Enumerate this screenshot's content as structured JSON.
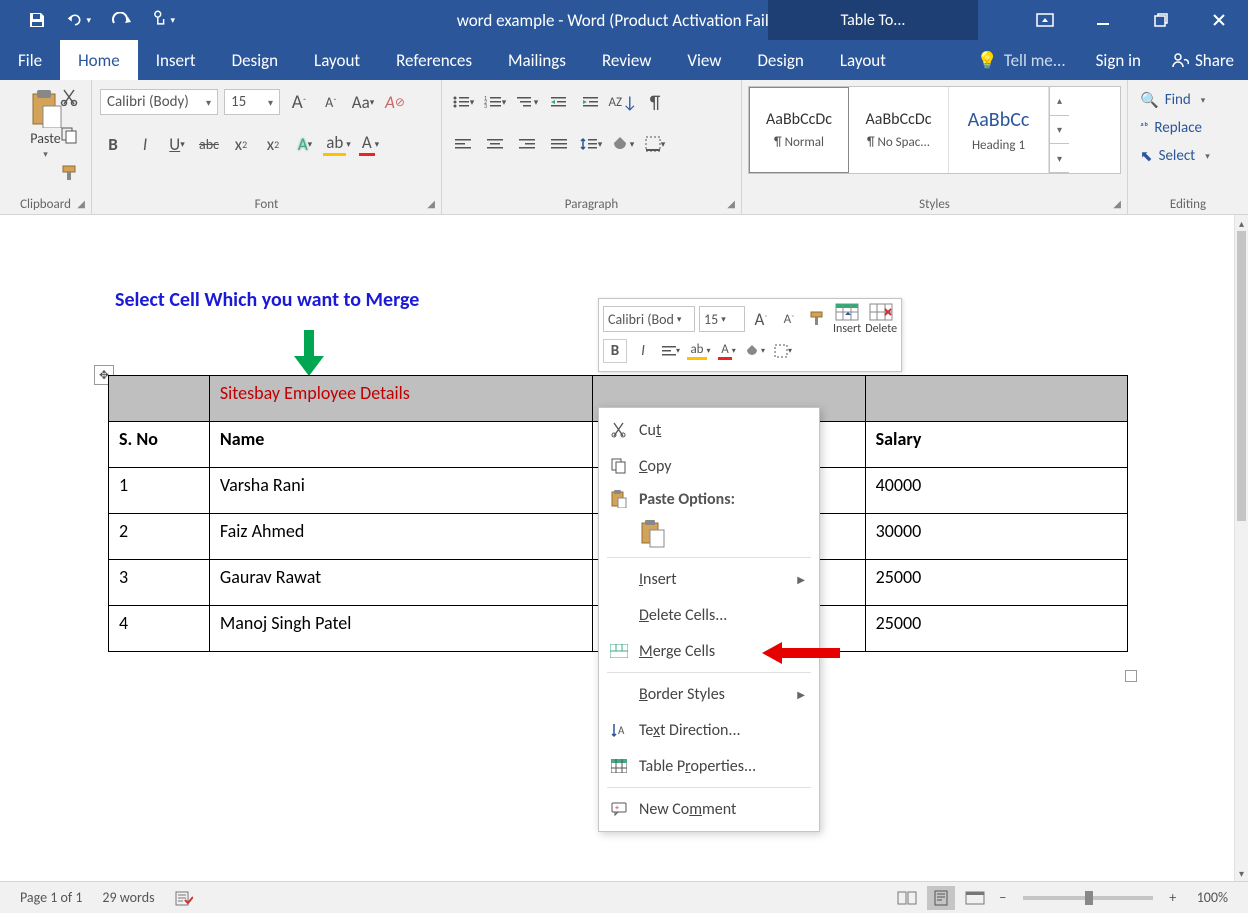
{
  "titlebar": {
    "title": "word example - Word (Product Activation Failed)",
    "table_tools": "Table To..."
  },
  "tabs": {
    "file": "File",
    "home": "Home",
    "insert": "Insert",
    "design": "Design",
    "layout": "Layout",
    "references": "References",
    "mailings": "Mailings",
    "review": "Review",
    "view": "View",
    "tt_design": "Design",
    "tt_layout": "Layout",
    "tell_me": "Tell me...",
    "sign_in": "Sign in",
    "share": "Share"
  },
  "ribbon": {
    "clipboard": {
      "paste": "Paste",
      "label": "Clipboard"
    },
    "font": {
      "name": "Calibri (Body)",
      "size": "15",
      "label": "Font",
      "grow": "A",
      "shrink": "A",
      "case": "Aa",
      "clear": "",
      "bold": "B",
      "italic": "I",
      "underline": "U",
      "strike": "abc",
      "sub": "x",
      "sup": "x",
      "effects": "A",
      "highlight": "",
      "color": "A"
    },
    "paragraph": {
      "label": "Paragraph"
    },
    "styles": {
      "label": "Styles",
      "sample": "AaBbCcDc",
      "sample_h": "AaBbCc",
      "normal": "¶ Normal",
      "nospace": "¶ No Spac...",
      "heading1": "Heading 1"
    },
    "editing": {
      "find": "Find",
      "replace": "Replace",
      "select": "Select",
      "label": "Editing"
    }
  },
  "workspace": {
    "instruction": "Select Cell Which you want to Merge",
    "table_title": "Sitesbay Employee Details",
    "headers": {
      "sno": "S. No",
      "name": "Name",
      "salary": "Salary"
    },
    "rows": [
      {
        "sno": "1",
        "name": "Varsha Rani",
        "salary": "40000"
      },
      {
        "sno": "2",
        "name": "Faiz Ahmed",
        "salary": "30000"
      },
      {
        "sno": "3",
        "name": "Gaurav Rawat",
        "salary": "25000"
      },
      {
        "sno": "4",
        "name": "Manoj Singh Patel",
        "salary": "25000"
      }
    ]
  },
  "mini": {
    "font": "Calibri (Bod",
    "size": "15",
    "insert": "Insert",
    "delete": "Delete"
  },
  "context": {
    "cut": "Cu",
    "cut2": "t",
    "copy": "C",
    "copy2": "opy",
    "paste_opts": "Paste Options:",
    "insert": "I",
    "insert2": "nsert",
    "delete_cells": "D",
    "delete_cells2": "elete Cells...",
    "merge": "M",
    "merge2": "erge Cells",
    "border": "B",
    "border2": "order Styles",
    "text_dir": "Te",
    "text_dir2": "x",
    "text_dir3": "t Direction...",
    "table_props": "Table P",
    "table_props2": "r",
    "table_props3": "operties...",
    "new_comment": "New Co",
    "new_comment2": "m",
    "new_comment3": "ment"
  },
  "status": {
    "page": "Page 1 of 1",
    "words": "29 words",
    "zoom": "100%"
  }
}
